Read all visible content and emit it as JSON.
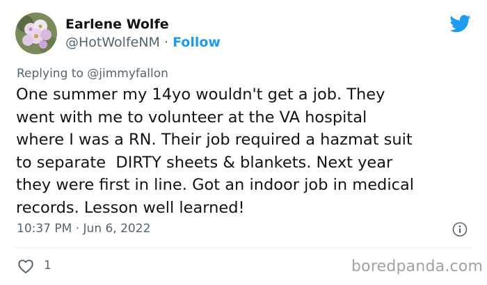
{
  "tweet": {
    "author_name": "Earlene Wolfe",
    "handle": "@HotWolfeNM",
    "separator": "·",
    "follow_label": "Follow",
    "replying_prefix": "Replying to ",
    "replying_to": "@jimmyfallon",
    "text": "One summer my 14yo wouldn't get a job. They\nwent with me to volunteer at the VA hospital\nwhere I was a RN. Their job required a hazmat suit\nto separate  DIRTY sheets & blankets. Next year\nthey were first in line. Got an indoor job in medical\nrecords. Lesson well learned!",
    "timestamp": "10:37 PM · Jun 6, 2022",
    "like_count": "1"
  },
  "icons": {
    "platform": "twitter-bird-icon",
    "info": "info-icon",
    "like": "heart-icon"
  },
  "colors": {
    "accent": "#1d9bf0",
    "muted": "#536471",
    "text": "#0f1419"
  },
  "watermark": "boredpanda.com"
}
